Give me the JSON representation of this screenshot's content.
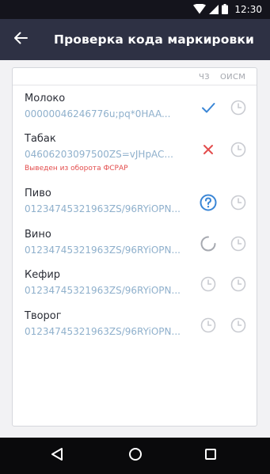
{
  "status_bar": {
    "time": "12:30",
    "icons": [
      "wifi-icon",
      "signal-icon",
      "battery-icon"
    ]
  },
  "app_bar": {
    "title": "Проверка кода маркировки",
    "back_icon": "arrow-left-icon"
  },
  "table": {
    "columns": [
      "ЧЗ",
      "ОИСМ"
    ],
    "rows": [
      {
        "name": "Молоко",
        "code": "00000046246776u;pq*0HAA...",
        "error": "",
        "chz_status": "check",
        "oism_status": "pending"
      },
      {
        "name": "Табак",
        "code": "04606203097500ZS=vJHpAC...",
        "error": "Выведен из оборота ФСРАР",
        "chz_status": "error",
        "oism_status": "pending"
      },
      {
        "name": "Пиво",
        "code": "01234745321963ZS/96RYiOPN...",
        "error": "",
        "chz_status": "question",
        "oism_status": "pending"
      },
      {
        "name": "Вино",
        "code": "01234745321963ZS/96RYiOPN...",
        "error": "",
        "chz_status": "loading",
        "oism_status": "pending"
      },
      {
        "name": "Кефир",
        "code": "01234745321963ZS/96RYiOPN...",
        "error": "",
        "chz_status": "pending",
        "oism_status": "pending"
      },
      {
        "name": "Творог",
        "code": "01234745321963ZS/96RYiOPN...",
        "error": "",
        "chz_status": "pending",
        "oism_status": "pending"
      }
    ]
  },
  "nav_bar": {
    "buttons": [
      "back-triangle-icon",
      "home-circle-icon",
      "recents-square-icon"
    ]
  },
  "colors": {
    "app_bar": "#2e3144",
    "check": "#3a86d6",
    "error": "#e34d4d",
    "pending": "#c9cbd1",
    "code_text": "#8fb0cc"
  }
}
